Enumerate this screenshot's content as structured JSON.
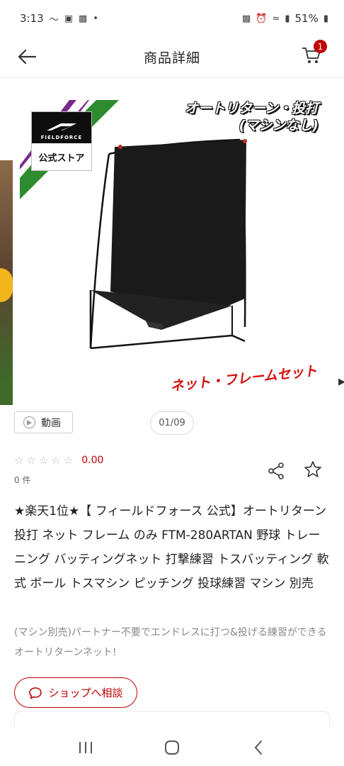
{
  "status_bar": {
    "time": "3:13",
    "battery": "51%"
  },
  "header": {
    "title": "商品詳細",
    "cart_count": "1"
  },
  "gallery": {
    "brand_name": "FIELDFORCE",
    "store_label": "公式ストア",
    "overlay_title_line1": "オートリターン・投打",
    "overlay_title_line2": "(マシンなし)",
    "overlay_set_label": "ネット・フレームセット",
    "net_brand": "FIELDFORCE"
  },
  "media_controls": {
    "video_label": "動画",
    "page_indicator": "01/09"
  },
  "rating": {
    "value": "0.00",
    "review_count": "0 件",
    "stars_filled": 0,
    "stars_total": 5
  },
  "product": {
    "title": "★楽天1位★【 フィールドフォース 公式】オートリターン 投打 ネット フレーム のみ FTM-280ARTAN 野球 トレーニング バッティングネット 打撃練習 トスバッティング 軟式 ボール トスマシン ピッチング 投球練習 マシン 別売",
    "description": "(マシン別売)パートナー不要でエンドレスに打つ&投げる練習ができるオートリターンネット!"
  },
  "actions": {
    "consult_label": "ショップへ相談"
  },
  "colors": {
    "accent": "#bf0000",
    "stripe_purple": "#7a2a8c",
    "stripe_green": "#2e8b2e"
  }
}
